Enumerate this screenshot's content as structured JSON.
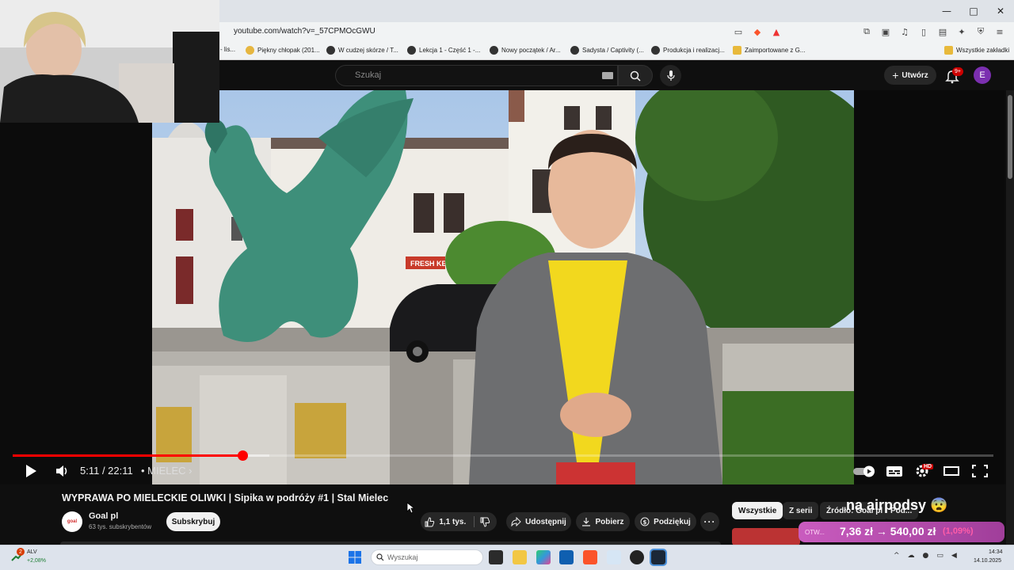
{
  "browser": {
    "url": "youtube.com/watch?v=_57CPMOcGWU",
    "window_controls": [
      "—",
      "□",
      "✕"
    ],
    "bookmarks": [
      {
        "label": "- lis...",
        "icon": "none"
      },
      {
        "label": "Piękny chłopak (201...",
        "icon": "yellow"
      },
      {
        "label": "W cudzej skórze / T...",
        "icon": "dark"
      },
      {
        "label": "Lekcja 1 - Część 1 -...",
        "icon": "dark"
      },
      {
        "label": "Nowy początek / Ar...",
        "icon": "dark"
      },
      {
        "label": "Sadysta / Captivity (...",
        "icon": "dark"
      },
      {
        "label": "Produkcja i realizacj...",
        "icon": "dark"
      },
      {
        "label": "Zaimportowane z G...",
        "icon": "folder"
      }
    ],
    "all_bookmarks": "Wszystkie zakładki"
  },
  "youtube": {
    "search_placeholder": "Szukaj",
    "create_label": "Utwórz",
    "notifications_badge": "9+",
    "avatar_letter": "E"
  },
  "player": {
    "current_time": "5:11",
    "duration": "22:11",
    "time_display": "5:11 / 22:11",
    "chapter": "• MIELEC ›",
    "progress_fraction": 0.234,
    "quality_badge": "HD"
  },
  "video": {
    "title": "WYPRAWA PO MIELECKIE OLIWKI | Sipika w podróży #1 | Stal Mielec",
    "channel_name": "Goal pl",
    "channel_avatar_text": "goal",
    "subscribers": "63 tys. subskrybentów",
    "subscribe_label": "Subskrybuj",
    "like_count": "1,1 tys.",
    "share_label": "Udostępnij",
    "download_label": "Pobierz",
    "thanks_label": "Podziękuj",
    "shop_sign": "FRESH KEBA"
  },
  "chips": [
    {
      "label": "Wszystkie",
      "active": true
    },
    {
      "label": "Z serii",
      "active": false
    },
    {
      "label": "Źródło: Goal pl",
      "active": false
    },
    {
      "label": "Pod...",
      "active": false
    }
  ],
  "ad": {
    "title": "na airpodsy 😨",
    "price": "7,36 zł → 540,00 zł",
    "percent": "(1,09%)",
    "small": "OTW..."
  },
  "taskbar": {
    "stock_badge": "2",
    "stock_name": "ALV",
    "stock_change": "+2,08%",
    "search_placeholder": "Wyszukaj",
    "time": "14:34",
    "date": "14.10.2025"
  }
}
